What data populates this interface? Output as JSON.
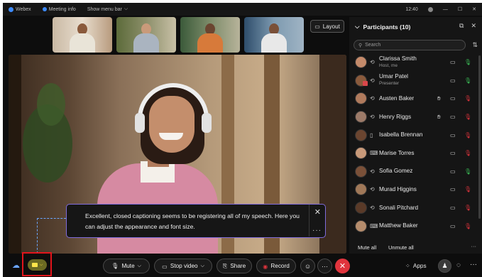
{
  "titlebar": {
    "app_name": "Webex",
    "meeting_info": "Meeting info",
    "menu_bar": "Show menu bar",
    "time": "12:40"
  },
  "layout_button": {
    "label": "Layout"
  },
  "caption": {
    "text": "Excellent, closed captioning seems to be registering all of my speech. Here you can adjust the appearance and font size.",
    "close_glyph": "✕",
    "more_glyph": "···"
  },
  "participants": {
    "title": "Participants (10)",
    "search_placeholder": "Search",
    "list": [
      {
        "name": "Clarissa Smith",
        "subtitle": "Host, me",
        "device_icon": "sync-icon",
        "mic": "on",
        "video": "on"
      },
      {
        "name": "Umar Patel",
        "subtitle": "Presenter",
        "device_icon": "sync-icon",
        "mic": "off",
        "video": "on"
      },
      {
        "name": "Austen Baker",
        "subtitle": "",
        "device_icon": "sync-icon",
        "mic": "muted",
        "video": "on"
      },
      {
        "name": "Henry Riggs",
        "subtitle": "",
        "device_icon": "sync-icon",
        "mic": "muted",
        "video": "on"
      },
      {
        "name": "Isabella Brennan",
        "subtitle": "",
        "device_icon": "phone-icon",
        "mic": "muted",
        "video": "on"
      },
      {
        "name": "Marise Torres",
        "subtitle": "",
        "device_icon": "laptop-icon",
        "mic": "muted",
        "video": "on"
      },
      {
        "name": "Sofia Gomez",
        "subtitle": "",
        "device_icon": "sync-icon",
        "mic": "on",
        "video": "on"
      },
      {
        "name": "Murad Higgins",
        "subtitle": "",
        "device_icon": "sync-icon",
        "mic": "muted",
        "video": "on"
      },
      {
        "name": "Sonali Pitchard",
        "subtitle": "",
        "device_icon": "sync-icon",
        "mic": "muted",
        "video": "on"
      },
      {
        "name": "Matthew Baker",
        "subtitle": "",
        "device_icon": "laptop-icon",
        "mic": "muted",
        "video": "on"
      }
    ],
    "mute_all": "Mute all",
    "unmute_all": "Unmute all"
  },
  "controls": {
    "mute": "Mute",
    "stop_video": "Stop video",
    "share": "Share",
    "record": "Record",
    "apps": "Apps"
  },
  "colors": {
    "accent_purple": "#7f6bdc",
    "leave_red": "#e0343d",
    "mic_on_green": "#3bbf57",
    "mic_muted_red": "#e0343d",
    "highlight_red": "#e3141b",
    "cc_yellow": "#ffe64a"
  }
}
